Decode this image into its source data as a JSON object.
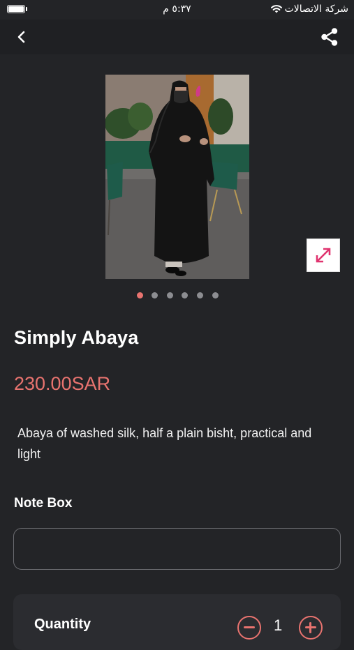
{
  "status_bar": {
    "carrier": "شركة الاتصالات",
    "time": "٥:٣٧ م"
  },
  "nav": {
    "back_icon": "chevron-left-icon",
    "share_icon": "share-icon"
  },
  "product": {
    "name": "Simply Abaya",
    "price": "230.00SAR",
    "description": "Abaya of washed silk, half a plain bisht, practical and light",
    "image_count": 6,
    "active_image_index": 0
  },
  "note_box": {
    "label": "Note Box",
    "value": ""
  },
  "quantity": {
    "label": "Quantity",
    "value": "1"
  },
  "colors": {
    "background": "#232427",
    "accent": "#e8736f"
  }
}
